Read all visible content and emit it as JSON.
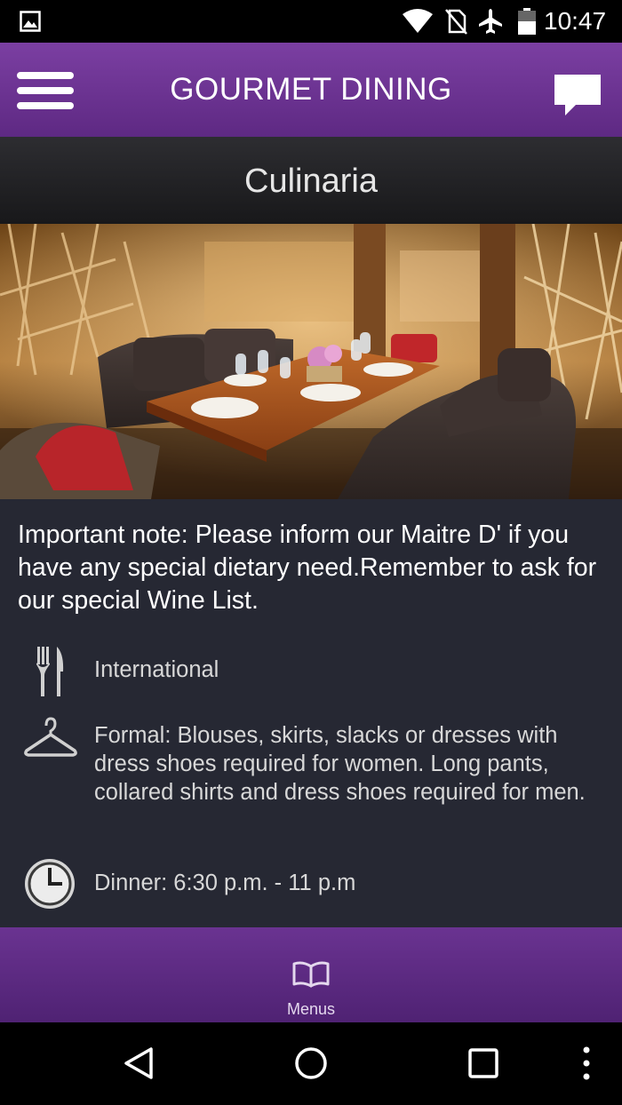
{
  "status_bar": {
    "time": "10:47",
    "icons": [
      "gallery-icon",
      "wifi-icon",
      "no-sim-icon",
      "airplane-icon",
      "battery-icon"
    ]
  },
  "app_bar": {
    "title": "GOURMET DINING",
    "left_icon": "menu-icon",
    "right_icon": "chat-icon"
  },
  "restaurant": {
    "name": "Culinaria",
    "note": "Important note: Please inform our Maitre D' if you have any special dietary need.Remember to ask for our special Wine List.",
    "cuisine": "International",
    "dress_code": "Formal: Blouses, skirts, slacks or dresses with dress shoes required for women. Long pants, collared shirts and dress shoes required for men.",
    "hours": "Dinner: 6:30 p.m. - 11 p.m"
  },
  "bottom_tab": {
    "label": "Menus",
    "icon": "book-icon"
  },
  "nav_bar": {
    "icons": [
      "back-icon",
      "home-icon",
      "recents-icon",
      "more-icon"
    ]
  },
  "colors": {
    "app_bar": "#6e3598",
    "content_bg": "#262833",
    "subheader": "#222226"
  }
}
